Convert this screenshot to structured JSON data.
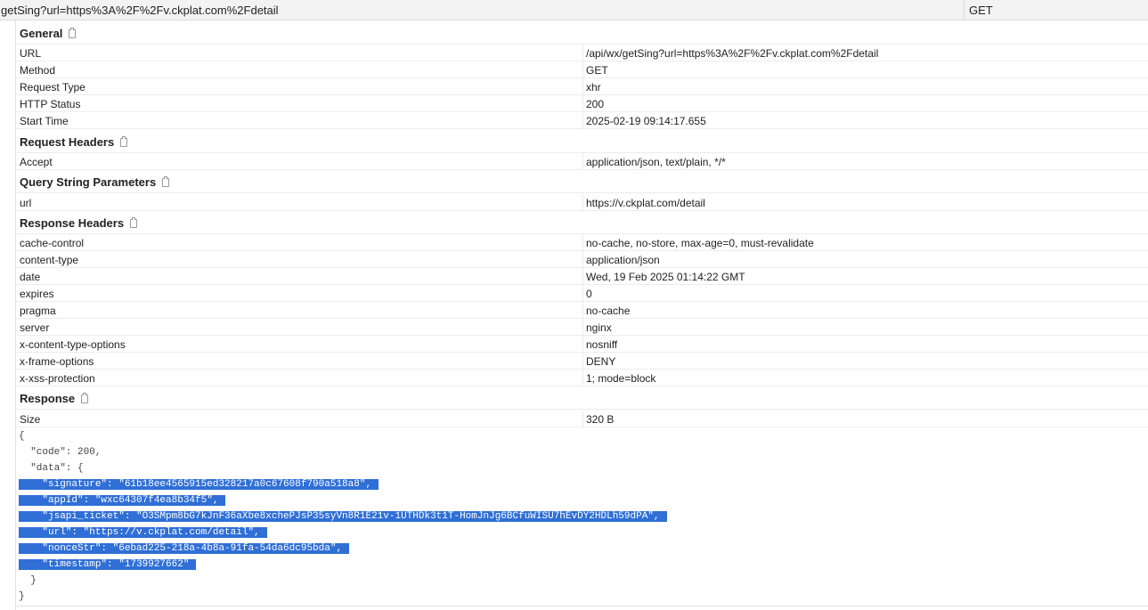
{
  "request_bar": {
    "name": "getSing?url=https%3A%2F%2Fv.ckplat.com%2Fdetail",
    "method": "GET"
  },
  "general": {
    "title": "General",
    "rows": [
      {
        "k": "URL",
        "v": "/api/wx/getSing?url=https%3A%2F%2Fv.ckplat.com%2Fdetail"
      },
      {
        "k": "Method",
        "v": "GET"
      },
      {
        "k": "Request Type",
        "v": "xhr"
      },
      {
        "k": "HTTP Status",
        "v": "200"
      },
      {
        "k": "Start Time",
        "v": "2025-02-19 09:14:17.655"
      }
    ]
  },
  "request_headers": {
    "title": "Request Headers",
    "rows": [
      {
        "k": "Accept",
        "v": "application/json, text/plain, */*"
      }
    ]
  },
  "query_params": {
    "title": "Query String Parameters",
    "rows": [
      {
        "k": "url",
        "v": "https://v.ckplat.com/detail"
      }
    ]
  },
  "response_headers": {
    "title": "Response Headers",
    "rows": [
      {
        "k": "cache-control",
        "v": "no-cache, no-store, max-age=0, must-revalidate"
      },
      {
        "k": "content-type",
        "v": "application/json"
      },
      {
        "k": "date",
        "v": "Wed, 19 Feb 2025 01:14:22 GMT"
      },
      {
        "k": "expires",
        "v": "0"
      },
      {
        "k": "pragma",
        "v": "no-cache"
      },
      {
        "k": "server",
        "v": "nginx"
      },
      {
        "k": "x-content-type-options",
        "v": "nosniff"
      },
      {
        "k": "x-frame-options",
        "v": "DENY"
      },
      {
        "k": "x-xss-protection",
        "v": "1; mode=block"
      }
    ]
  },
  "response": {
    "title": "Response",
    "rows": [
      {
        "k": "Size",
        "v": "320 B"
      }
    ],
    "body_lines": [
      {
        "text": "{",
        "selected": false
      },
      {
        "text": "  \"code\": 200,",
        "selected": false
      },
      {
        "text": "  \"data\": {",
        "selected": false
      },
      {
        "text": "\"signature\": \"61b18ee4565915ed328217a0c67608f790a518a8\",",
        "selected": true
      },
      {
        "text": "\"appId\": \"wxc64307f4ea8b34f5\",",
        "selected": true
      },
      {
        "text": "\"jsapi_ticket\": \"O3SMpm8bG7kJnF36aXbe8xchePJsP35syVn8R1E21v-1UTHDk3t1T-HomJnJg6BCfuWISU7hEvDY2HDLh59dPA\",",
        "selected": true
      },
      {
        "text": "\"url\": \"https://v.ckplat.com/detail\",",
        "selected": true
      },
      {
        "text": "\"nonceStr\": \"6ebad225-218a-4b8a-91fa-54da6dc95bda\",",
        "selected": true
      },
      {
        "text": "\"timestamp\": \"1739927662\"",
        "selected": true
      },
      {
        "text": "  }",
        "selected": false
      },
      {
        "text": "}",
        "selected": false
      }
    ]
  },
  "colors": {
    "selection": "#2f6fd6",
    "border": "#ececec"
  },
  "icons": {
    "section_copy": "clipboard-icon"
  }
}
